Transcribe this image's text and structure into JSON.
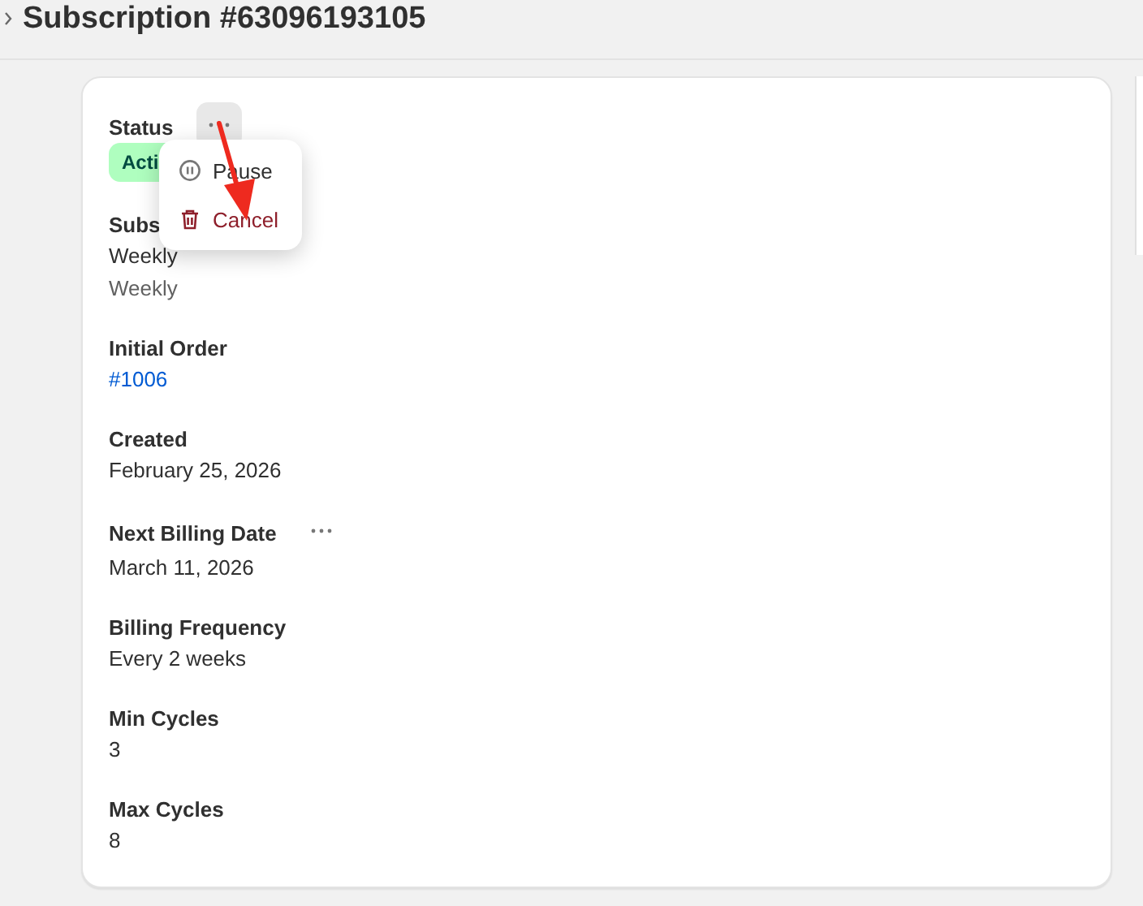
{
  "header": {
    "title": "Subscription #63096193105"
  },
  "fields": [
    {
      "label": "Status",
      "kind": "badge",
      "more_button": {
        "hovered": true
      },
      "values": [
        "Acti"
      ]
    },
    {
      "label": "Subs",
      "kind": "text",
      "values": [
        "Weekly"
      ],
      "note": "Weekly"
    },
    {
      "label": "Initial Order",
      "kind": "link",
      "values": [
        "#1006"
      ]
    },
    {
      "label": "Created",
      "kind": "text",
      "values": [
        "February 25, 2026"
      ]
    },
    {
      "label": "Next Billing Date",
      "kind": "text",
      "more_button": {
        "hovered": false
      },
      "values": [
        "March 11, 2026"
      ]
    },
    {
      "label": "Billing Frequency",
      "kind": "text",
      "values": [
        "Every 2 weeks"
      ]
    },
    {
      "label": "Min Cycles",
      "kind": "text",
      "values": [
        "3"
      ]
    },
    {
      "label": "Max Cycles",
      "kind": "text",
      "values": [
        "8"
      ]
    }
  ],
  "status_menu": {
    "items": [
      {
        "label": "Pause",
        "kind": "pause"
      },
      {
        "label": "Cancel",
        "kind": "delete"
      }
    ]
  }
}
